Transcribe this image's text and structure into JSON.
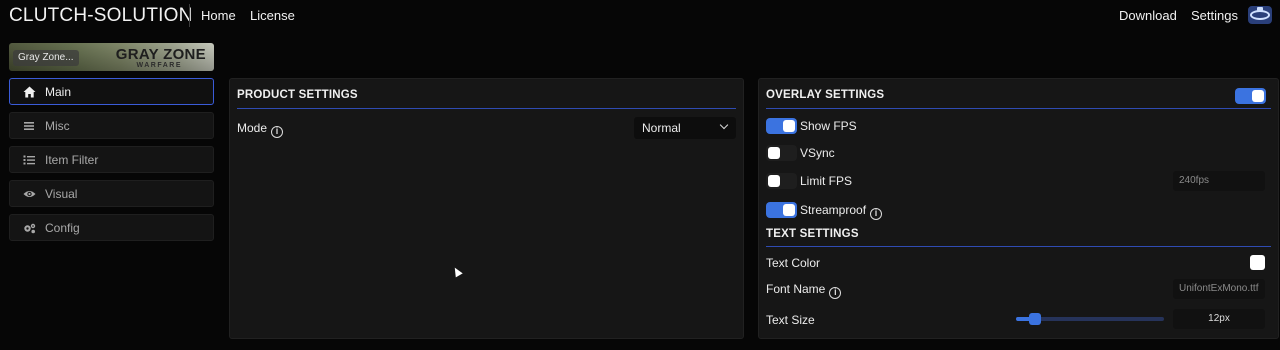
{
  "header": {
    "brand": "CLUTCH-SOLUTION",
    "nav": {
      "home": "Home",
      "license": "License",
      "download": "Download",
      "settings": "Settings"
    }
  },
  "banner": {
    "game_label": "Gray Zone...",
    "logo_main": "GRAY ZONE",
    "logo_sub": "WARFARE"
  },
  "sidebar": {
    "items": [
      {
        "label": "Main",
        "icon": "home-icon",
        "active": true
      },
      {
        "label": "Misc",
        "icon": "menu-icon",
        "active": false
      },
      {
        "label": "Item Filter",
        "icon": "list-icon",
        "active": false
      },
      {
        "label": "Visual",
        "icon": "eye-icon",
        "active": false
      },
      {
        "label": "Config",
        "icon": "gears-icon",
        "active": false
      }
    ]
  },
  "product": {
    "title": "PRODUCT SETTINGS",
    "mode_label": "Mode",
    "mode_value": "Normal"
  },
  "overlay": {
    "title": "OVERLAY SETTINGS",
    "enabled": true,
    "show_fps": {
      "label": "Show FPS",
      "on": true
    },
    "vsync": {
      "label": "VSync",
      "on": false
    },
    "limit_fps": {
      "label": "Limit FPS",
      "on": false,
      "placeholder": "240fps"
    },
    "streamproof": {
      "label": "Streamproof",
      "on": true
    }
  },
  "text_settings": {
    "title": "TEXT SETTINGS",
    "text_color_label": "Text Color",
    "text_color": "#ffffff",
    "font_name_label": "Font Name",
    "font_name_placeholder": "UnifontExMono.ttf",
    "text_size_label": "Text Size",
    "text_size_value": "12px",
    "text_size_fraction": 0.13
  },
  "colors": {
    "accent": "#3b73e0",
    "rule": "#2f4bb2",
    "background": "#060606",
    "panel": "#161616"
  }
}
